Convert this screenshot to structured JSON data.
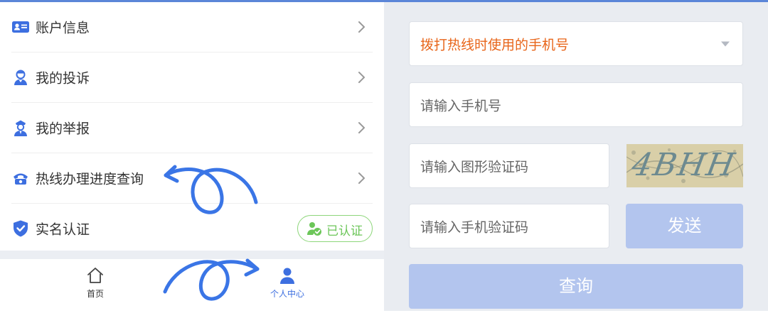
{
  "menu": {
    "items": [
      {
        "label": "账户信息",
        "icon": "id-card-icon"
      },
      {
        "label": "我的投诉",
        "icon": "user-complaint-icon"
      },
      {
        "label": "我的举报",
        "icon": "police-officer-icon"
      },
      {
        "label": "热线办理进度查询",
        "icon": "telephone-icon"
      }
    ],
    "verify": {
      "label": "实名认证",
      "icon": "shield-check-icon",
      "badge": "已认证"
    }
  },
  "tabbar": {
    "home": {
      "label": "首页",
      "icon": "home-icon"
    },
    "profile": {
      "label": "个人中心",
      "icon": "person-icon"
    }
  },
  "form": {
    "phone_select_placeholder": "拨打热线时使用的手机号",
    "phone_input_placeholder": "请输入手机号",
    "captcha_input_placeholder": "请输入图形验证码",
    "captcha_text": "4BHH",
    "sms_input_placeholder": "请输入手机验证码",
    "send_label": "发送",
    "query_label": "查询"
  },
  "colors": {
    "accent": "#3d6fe0",
    "placeholder_highlight": "#e8651a",
    "verified_green": "#6cc659",
    "disabled_button": "#b3c5ee",
    "annotation_arrow": "#3a75e6"
  }
}
